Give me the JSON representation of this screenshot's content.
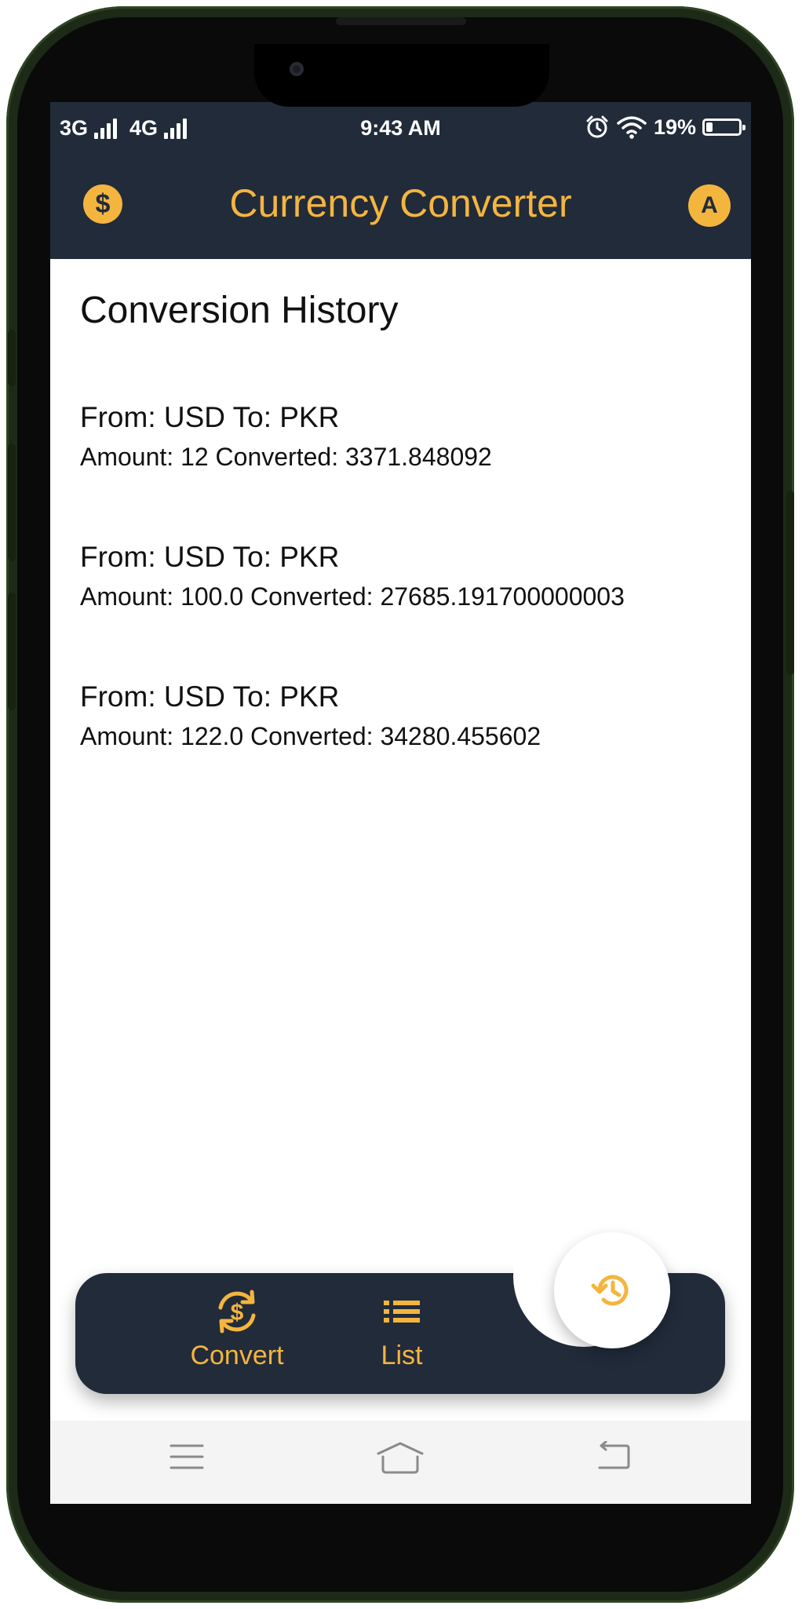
{
  "status_bar": {
    "network_1": "3G",
    "network_2": "4G",
    "time": "9:43 AM",
    "battery": "19%",
    "battery_level": 0.19
  },
  "app_bar": {
    "title": "Currency Converter",
    "logo_glyph": "$",
    "avatar_letter": "A"
  },
  "page": {
    "title": "Conversion History"
  },
  "history": [
    {
      "route": "From: USD To: PKR",
      "amounts": "Amount: 12 Converted: 3371.848092"
    },
    {
      "route": "From: USD To: PKR",
      "amounts": "Amount: 100.0 Converted: 27685.191700000003"
    },
    {
      "route": "From: USD To: PKR",
      "amounts": "Amount: 122.0 Converted: 34280.455602"
    }
  ],
  "bottom_nav": {
    "items": [
      {
        "label": "Convert",
        "icon": "currency-exchange-icon"
      },
      {
        "label": "List",
        "icon": "list-icon"
      }
    ],
    "fab_icon": "history-icon"
  },
  "system_nav": {
    "icons": [
      "menu-icon",
      "home-icon",
      "back-icon"
    ]
  },
  "colors": {
    "primary_dark": "#212b3a",
    "accent": "#f4b53f",
    "background": "#ffffff",
    "text": "#111111"
  }
}
